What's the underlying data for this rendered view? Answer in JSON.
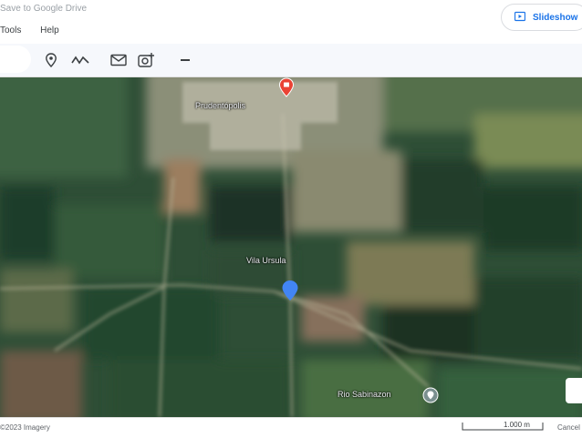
{
  "header": {
    "save_link": "Save to Google Drive",
    "slideshow_label": "Slideshow",
    "menu": [
      "Tools",
      "Help"
    ]
  },
  "toolbar": {
    "icons": [
      "placemark-icon",
      "path-icon",
      "email-icon",
      "add-photo-icon",
      "collapse-icon"
    ]
  },
  "map": {
    "town_label": "Prudentópolis",
    "area_label": "Vila Ursula",
    "poi_label": "Rio Sabinazon"
  },
  "status": {
    "copyright": "©2023 Imagery",
    "scale_label": "1.000 m",
    "cancel_label": "Cancel"
  }
}
